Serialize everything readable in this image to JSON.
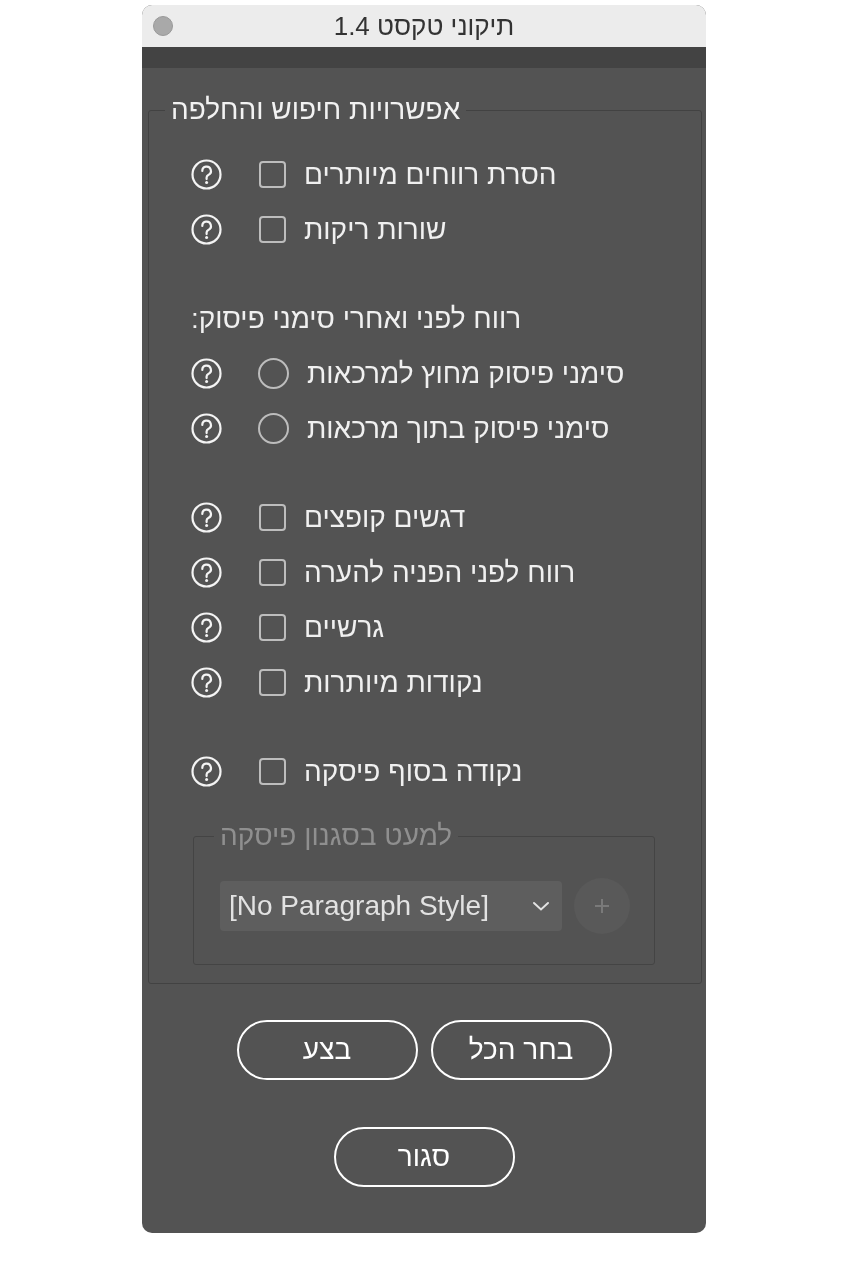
{
  "window": {
    "title": "תיקוני טקסט 1.4"
  },
  "options_group": {
    "legend": "אפשרויות חיפוש והחלפה",
    "sections": [
      {
        "items": [
          {
            "kind": "checkbox",
            "label": "הסרת רווחים מיותרים",
            "checked": false
          },
          {
            "kind": "checkbox",
            "label": "שורות ריקות",
            "checked": false
          }
        ]
      },
      {
        "heading": "רווח לפני ואחרי סימני פיסוק:",
        "items": [
          {
            "kind": "radio",
            "label": "סימני פיסוק מחוץ למרכאות",
            "selected": false
          },
          {
            "kind": "radio",
            "label": "סימני פיסוק בתוך מרכאות",
            "selected": false
          }
        ]
      },
      {
        "items": [
          {
            "kind": "checkbox",
            "label": "דגשים קופצים",
            "checked": false
          },
          {
            "kind": "checkbox",
            "label": "רווח לפני הפניה להערה",
            "checked": false
          },
          {
            "kind": "checkbox",
            "label": "גרשיים",
            "checked": false
          },
          {
            "kind": "checkbox",
            "label": "נקודות מיותרות",
            "checked": false
          }
        ]
      },
      {
        "items": [
          {
            "kind": "checkbox",
            "label": "נקודה בסוף פיסקה",
            "checked": false
          }
        ]
      }
    ],
    "exclude_group": {
      "legend": "למעט בסגנון פיסקה",
      "style_dropdown": {
        "value": "[No Paragraph Style]"
      },
      "add_button": {
        "disabled": true
      }
    }
  },
  "button_rows": [
    [
      {
        "label": "בחר הכל"
      },
      {
        "label": "בצע"
      }
    ],
    [
      {
        "label": "סגור"
      }
    ]
  ]
}
